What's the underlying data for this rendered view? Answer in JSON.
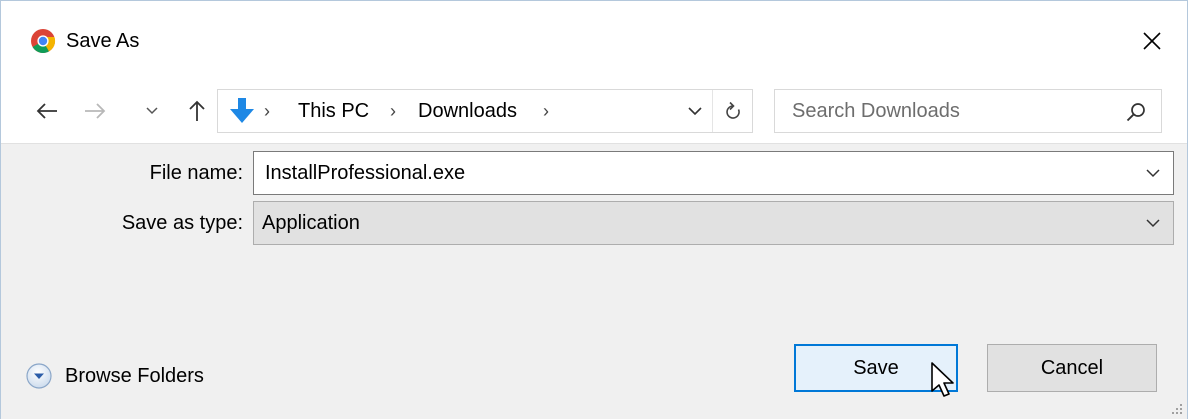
{
  "window": {
    "title": "Save As",
    "icon": "chrome-icon"
  },
  "nav": {
    "back_icon": "back-arrow-icon",
    "forward_icon": "forward-arrow-icon",
    "recent_icon": "chevron-down-icon",
    "up_icon": "up-arrow-icon"
  },
  "address": {
    "location_icon": "downloads-arrow-icon",
    "crumbs": [
      "This PC",
      "Downloads"
    ],
    "separator": "›"
  },
  "search": {
    "placeholder": "Search Downloads"
  },
  "form": {
    "file_name_label": "File name:",
    "file_name_value": "InstallProfessional.exe",
    "save_type_label": "Save as type:",
    "save_type_value": "Application"
  },
  "footer": {
    "browse_label": "Browse Folders",
    "save_label": "Save",
    "cancel_label": "Cancel"
  },
  "colors": {
    "accent": "#0078d7",
    "save_bg": "#e5f1fb",
    "form_bg": "#f0f0f0",
    "download_arrow": "#1e88e5"
  }
}
